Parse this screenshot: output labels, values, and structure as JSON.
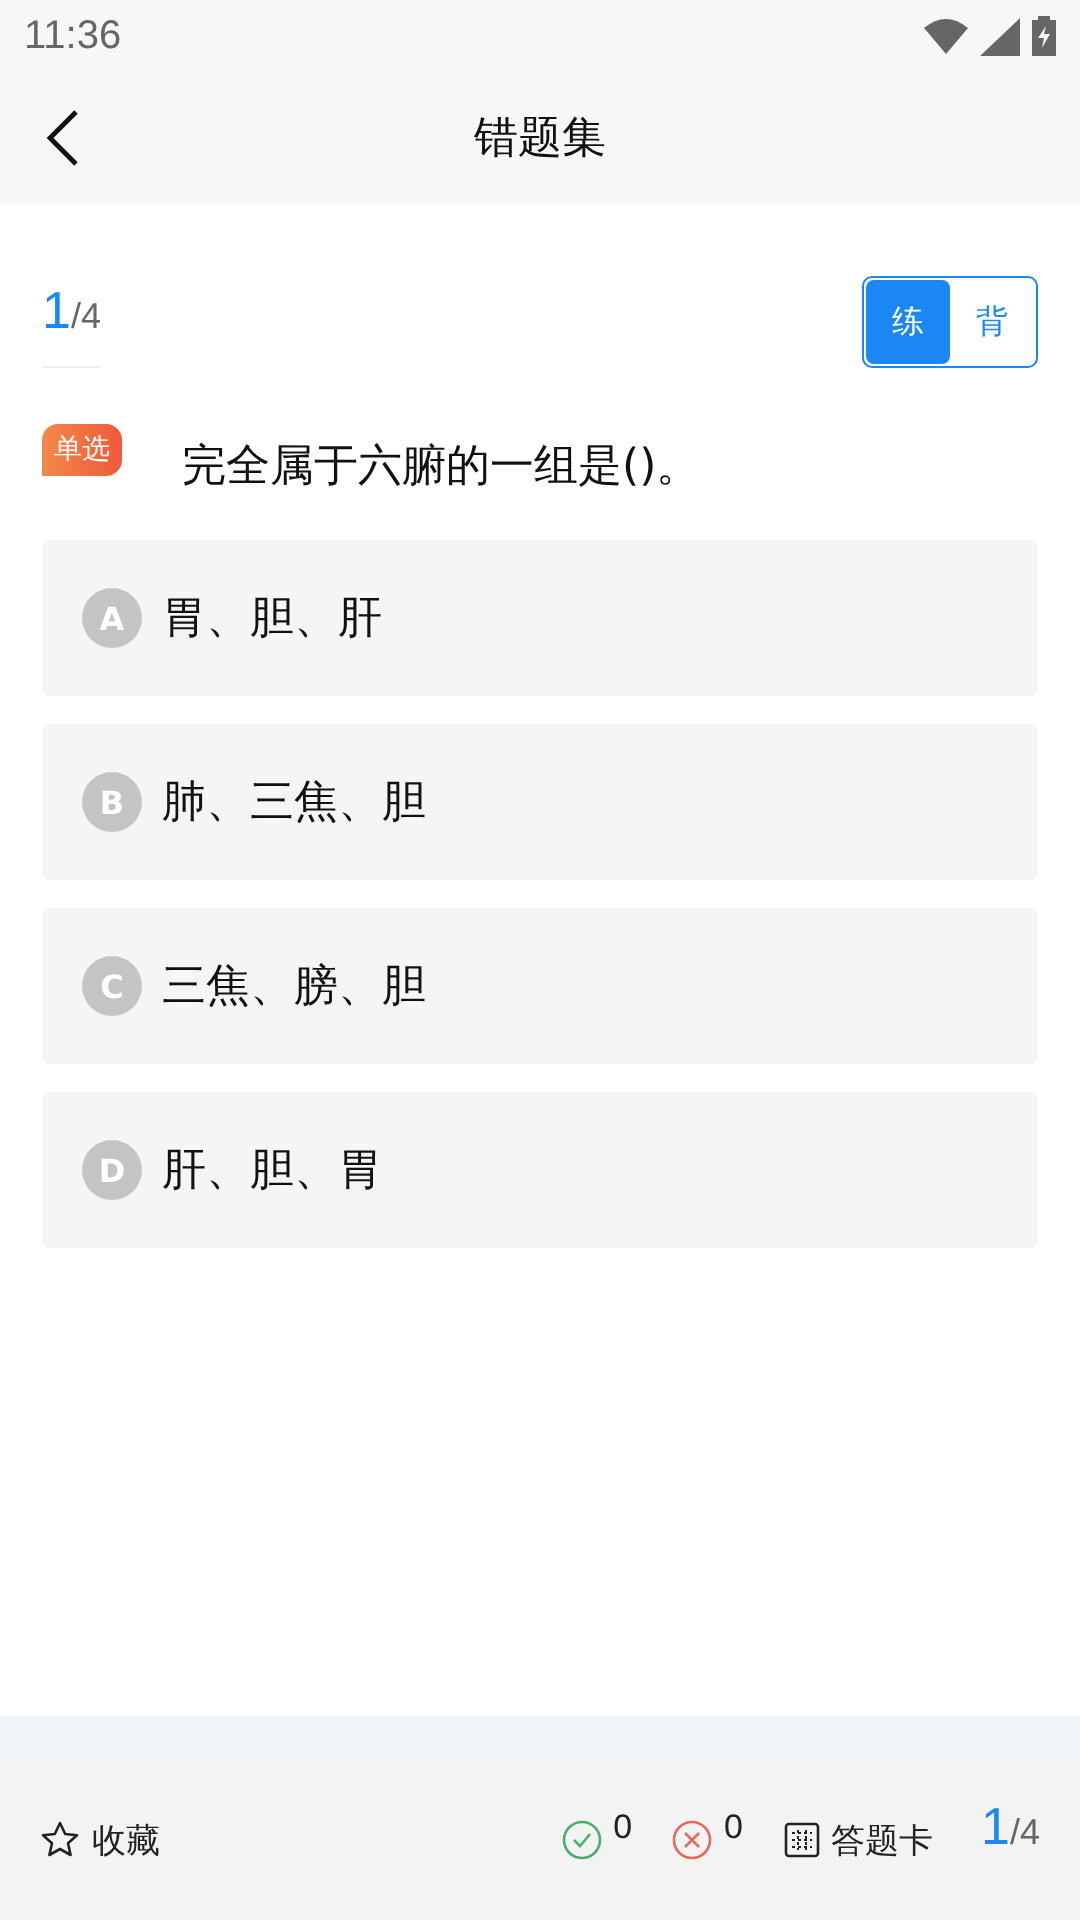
{
  "status_bar": {
    "time": "11:36"
  },
  "header": {
    "title": "错题集"
  },
  "progress": {
    "current": "1",
    "total": "/4"
  },
  "modes": [
    {
      "label": "练",
      "selected": true
    },
    {
      "label": "背",
      "selected": false
    }
  ],
  "question": {
    "type": "单选",
    "text": "完全属于六腑的一组是()。"
  },
  "options": [
    {
      "letter": "A",
      "text": "胃、胆、肝"
    },
    {
      "letter": "B",
      "text": "肺、三焦、胆"
    },
    {
      "letter": "C",
      "text": "三焦、膀、胆"
    },
    {
      "letter": "D",
      "text": "肝、胆、胃"
    }
  ],
  "bottom_bar": {
    "favorite": "收藏",
    "correct": "0",
    "wrong": "0",
    "answer_card": "答题卡",
    "current": "1",
    "total": "/4"
  }
}
